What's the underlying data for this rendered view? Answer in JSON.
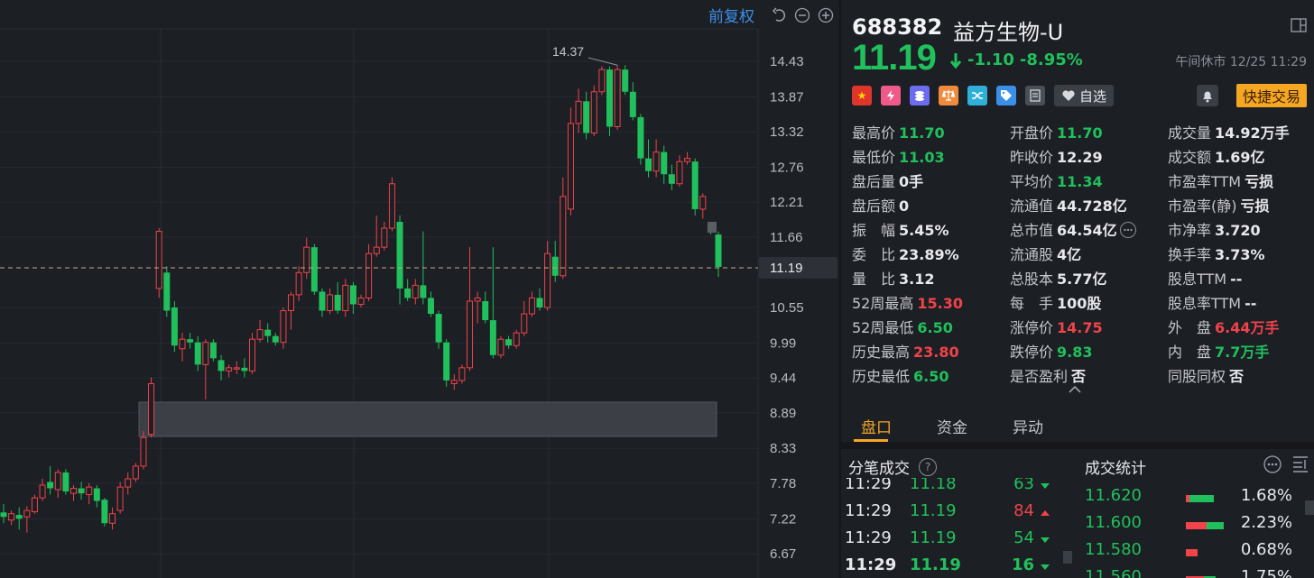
{
  "toolbar": {
    "adjust_label": "前复权",
    "icons": [
      "undo-icon",
      "zoom-out-icon",
      "zoom-in-icon"
    ]
  },
  "chart_data": {
    "type": "candlestick",
    "y_ticks": [
      "14.43",
      "13.87",
      "13.32",
      "12.76",
      "12.21",
      "11.66",
      "11.19",
      "10.55",
      "9.99",
      "9.44",
      "8.89",
      "8.33",
      "7.78",
      "7.22",
      "6.67"
    ],
    "current_price_label": "11.19",
    "high_annotation": "14.37",
    "ylim": [
      6.5,
      14.75
    ],
    "candles": [
      [
        7.32,
        7.25,
        7.45,
        7.15
      ],
      [
        7.2,
        7.3,
        7.35,
        7.12
      ],
      [
        7.28,
        7.22,
        7.4,
        7.05
      ],
      [
        7.25,
        7.35,
        7.42,
        7.0
      ],
      [
        7.33,
        7.55,
        7.6,
        7.3
      ],
      [
        7.55,
        7.75,
        7.85,
        7.5
      ],
      [
        7.8,
        7.7,
        8.05,
        7.6
      ],
      [
        7.68,
        7.95,
        8.0,
        7.55
      ],
      [
        7.95,
        7.65,
        8.0,
        7.6
      ],
      [
        7.62,
        7.7,
        7.75,
        7.5
      ],
      [
        7.7,
        7.62,
        7.8,
        7.52
      ],
      [
        7.6,
        7.72,
        7.78,
        7.45
      ],
      [
        7.7,
        7.5,
        7.75,
        7.4
      ],
      [
        7.52,
        7.15,
        7.55,
        7.1
      ],
      [
        7.15,
        7.3,
        7.4,
        7.05
      ],
      [
        7.35,
        7.72,
        7.8,
        7.3
      ],
      [
        7.72,
        7.85,
        7.95,
        7.6
      ],
      [
        7.85,
        8.05,
        8.1,
        7.8
      ],
      [
        8.05,
        8.5,
        8.6,
        8.0
      ],
      [
        8.55,
        9.35,
        9.45,
        8.5
      ],
      [
        10.85,
        11.75,
        11.8,
        10.7
      ],
      [
        11.1,
        10.5,
        11.2,
        10.4
      ],
      [
        10.55,
        9.95,
        10.65,
        9.85
      ],
      [
        9.9,
        10.05,
        10.15,
        9.7
      ],
      [
        10.05,
        10.0,
        10.15,
        9.9
      ],
      [
        10.0,
        9.65,
        10.1,
        9.55
      ],
      [
        9.65,
        10.0,
        10.05,
        9.1
      ],
      [
        10.0,
        9.75,
        10.05,
        9.7
      ],
      [
        9.72,
        9.55,
        9.8,
        9.4
      ],
      [
        9.55,
        9.6,
        9.65,
        9.45
      ],
      [
        9.58,
        9.6,
        9.7,
        9.5
      ],
      [
        9.6,
        9.55,
        9.75,
        9.45
      ],
      [
        9.55,
        10.05,
        10.15,
        9.5
      ],
      [
        10.05,
        10.2,
        10.35,
        10.0
      ],
      [
        10.2,
        10.1,
        10.3,
        10.0
      ],
      [
        10.1,
        10.0,
        10.15,
        9.95
      ],
      [
        10.0,
        10.5,
        10.55,
        9.9
      ],
      [
        10.5,
        10.75,
        10.8,
        10.2
      ],
      [
        10.75,
        11.1,
        11.2,
        10.65
      ],
      [
        11.1,
        11.5,
        11.65,
        11.0
      ],
      [
        11.5,
        10.8,
        11.55,
        10.75
      ],
      [
        10.8,
        10.5,
        10.85,
        10.4
      ],
      [
        10.5,
        10.75,
        10.85,
        10.45
      ],
      [
        10.75,
        10.5,
        10.95,
        10.45
      ],
      [
        10.5,
        10.9,
        11.0,
        10.4
      ],
      [
        10.9,
        10.6,
        10.95,
        10.45
      ],
      [
        10.6,
        10.7,
        10.75,
        10.55
      ],
      [
        10.7,
        11.4,
        11.55,
        10.65
      ],
      [
        11.4,
        11.5,
        12.0,
        11.35
      ],
      [
        11.5,
        11.8,
        11.9,
        11.45
      ],
      [
        11.8,
        12.5,
        12.6,
        11.75
      ],
      [
        11.9,
        10.85,
        12.0,
        10.6
      ],
      [
        10.85,
        10.7,
        11.0,
        10.65
      ],
      [
        10.7,
        10.9,
        11.0,
        10.6
      ],
      [
        10.9,
        10.7,
        11.75,
        10.6
      ],
      [
        10.7,
        10.45,
        10.8,
        10.4
      ],
      [
        10.45,
        10.0,
        10.5,
        9.9
      ],
      [
        10.0,
        9.4,
        10.05,
        9.3
      ],
      [
        9.35,
        9.4,
        9.5,
        9.25
      ],
      [
        9.4,
        9.6,
        9.65,
        9.35
      ],
      [
        9.6,
        10.65,
        11.5,
        9.55
      ],
      [
        10.65,
        10.7,
        10.8,
        10.3
      ],
      [
        10.65,
        10.35,
        10.8,
        10.3
      ],
      [
        10.35,
        9.8,
        11.5,
        9.75
      ],
      [
        9.8,
        10.05,
        10.1,
        9.75
      ],
      [
        10.05,
        9.95,
        10.1,
        9.9
      ],
      [
        9.95,
        10.15,
        10.2,
        9.9
      ],
      [
        10.15,
        10.45,
        10.65,
        10.1
      ],
      [
        10.45,
        10.7,
        10.8,
        10.4
      ],
      [
        10.7,
        10.55,
        10.85,
        10.5
      ],
      [
        10.55,
        11.4,
        11.6,
        10.5
      ],
      [
        11.35,
        11.05,
        11.6,
        10.95
      ],
      [
        11.05,
        12.3,
        12.6,
        11.0
      ],
      [
        12.1,
        13.45,
        13.7,
        12.0
      ],
      [
        13.45,
        13.8,
        14.0,
        13.3
      ],
      [
        13.8,
        13.3,
        13.95,
        13.2
      ],
      [
        13.3,
        13.95,
        14.05,
        13.25
      ],
      [
        13.95,
        14.3,
        14.35,
        13.9
      ],
      [
        14.3,
        13.4,
        14.35,
        13.25
      ],
      [
        13.4,
        14.3,
        14.37,
        13.35
      ],
      [
        14.3,
        13.95,
        14.37,
        13.9
      ],
      [
        13.95,
        13.55,
        14.1,
        13.5
      ],
      [
        13.55,
        12.9,
        13.6,
        12.8
      ],
      [
        12.9,
        12.7,
        13.2,
        12.6
      ],
      [
        12.7,
        13.0,
        13.2,
        12.6
      ],
      [
        13.0,
        12.65,
        13.1,
        12.5
      ],
      [
        12.65,
        12.5,
        12.8,
        12.4
      ],
      [
        12.5,
        12.85,
        12.95,
        12.45
      ],
      [
        12.85,
        12.9,
        13.0,
        12.8
      ],
      [
        12.85,
        12.1,
        12.9,
        12.0
      ],
      [
        12.1,
        12.3,
        12.35,
        11.95
      ],
      [
        11.85,
        11.75,
        11.9,
        11.7
      ],
      [
        11.7,
        11.19,
        11.75,
        11.03
      ]
    ]
  },
  "header": {
    "code": "688382",
    "name": "益方生物-U",
    "price": "11.19",
    "change": "-1.10",
    "change_pct": "-8.95%",
    "status": "午间休市 12/25 11:29",
    "watch_label": "自选",
    "quick_trade_label": "快捷交易",
    "tag_icons": [
      "china-flag-icon",
      "margin-icon",
      "coin-stack-icon",
      "scale-icon",
      "shuffle-icon",
      "tag-icon",
      "document-icon"
    ]
  },
  "stats": [
    [
      {
        "label": "最高价",
        "value": "11.70",
        "color": "green"
      },
      {
        "label": "开盘价",
        "value": "11.70",
        "color": "green"
      },
      {
        "label": "成交量",
        "value": "14.92万手",
        "color": "white"
      }
    ],
    [
      {
        "label": "最低价",
        "value": "11.03",
        "color": "green"
      },
      {
        "label": "昨收价",
        "value": "12.29",
        "color": "white"
      },
      {
        "label": "成交额",
        "value": "1.69亿",
        "color": "white"
      }
    ],
    [
      {
        "label": "盘后量",
        "value": "0手",
        "color": "white"
      },
      {
        "label": "平均价",
        "value": "11.34",
        "color": "green"
      },
      {
        "label": "市盈率TTM",
        "value": "亏损",
        "color": "white"
      }
    ],
    [
      {
        "label": "盘后额",
        "value": "0",
        "color": "white"
      },
      {
        "label": "流通值",
        "value": "44.728亿",
        "color": "white"
      },
      {
        "label": "市盈率(静)",
        "value": "亏损",
        "color": "white"
      }
    ],
    [
      {
        "label": "振　幅",
        "value": "5.45%",
        "color": "white"
      },
      {
        "label": "总市值",
        "value": "64.54亿",
        "color": "white"
      },
      {
        "label": "市净率",
        "value": "3.720",
        "color": "white"
      }
    ],
    [
      {
        "label": "委　比",
        "value": "23.89%",
        "color": "white"
      },
      {
        "label": "流通股",
        "value": "4亿",
        "color": "white"
      },
      {
        "label": "换手率",
        "value": "3.73%",
        "color": "white"
      }
    ],
    [
      {
        "label": "量　比",
        "value": "3.12",
        "color": "white"
      },
      {
        "label": "总股本",
        "value": "5.77亿",
        "color": "white"
      },
      {
        "label": "股息TTM",
        "value": "--",
        "color": "white"
      }
    ],
    [
      {
        "label": "52周最高",
        "value": "15.30",
        "color": "red"
      },
      {
        "label": "每　手",
        "value": "100股",
        "color": "white"
      },
      {
        "label": "股息率TTM",
        "value": "--",
        "color": "white"
      }
    ],
    [
      {
        "label": "52周最低",
        "value": "6.50",
        "color": "green"
      },
      {
        "label": "涨停价",
        "value": "14.75",
        "color": "red"
      },
      {
        "label": "外　盘",
        "value": "6.44万手",
        "color": "red"
      }
    ],
    [
      {
        "label": "历史最高",
        "value": "23.80",
        "color": "red"
      },
      {
        "label": "跌停价",
        "value": "9.83",
        "color": "green"
      },
      {
        "label": "内　盘",
        "value": "7.7万手",
        "color": "green"
      }
    ],
    [
      {
        "label": "历史最低",
        "value": "6.50",
        "color": "green"
      },
      {
        "label": "是否盈利",
        "value": "否",
        "color": "white"
      },
      {
        "label": "同股同权",
        "value": "否",
        "color": "white"
      }
    ]
  ],
  "tabs": [
    "盘口",
    "资金",
    "异动"
  ],
  "ticks": {
    "title": "分笔成交",
    "rows": [
      {
        "time": "11:29",
        "price": "11.18",
        "vol": "63",
        "dir": "down"
      },
      {
        "time": "11:29",
        "price": "11.19",
        "vol": "84",
        "dir": "up"
      },
      {
        "time": "11:29",
        "price": "11.19",
        "vol": "54",
        "dir": "down"
      },
      {
        "time": "11:29",
        "price": "11.19",
        "vol": "16",
        "dir": "down"
      }
    ]
  },
  "distribution": {
    "title": "成交统计",
    "rows": [
      {
        "price": "11.620",
        "pct": "1.68%",
        "red": 0.12,
        "green": 0.88,
        "total": 0.42
      },
      {
        "price": "11.600",
        "pct": "2.23%",
        "red": 0.55,
        "green": 0.45,
        "total": 0.56
      },
      {
        "price": "11.580",
        "pct": "0.68%",
        "red": 1.0,
        "green": 0.0,
        "total": 0.17
      },
      {
        "price": "11.560",
        "pct": "1.75%",
        "red": 0.6,
        "green": 0.4,
        "total": 0.44
      }
    ]
  },
  "colors": {
    "up": "#f0434a",
    "down": "#20c05c",
    "accent": "#f5a623",
    "link": "#3d8fe8"
  }
}
